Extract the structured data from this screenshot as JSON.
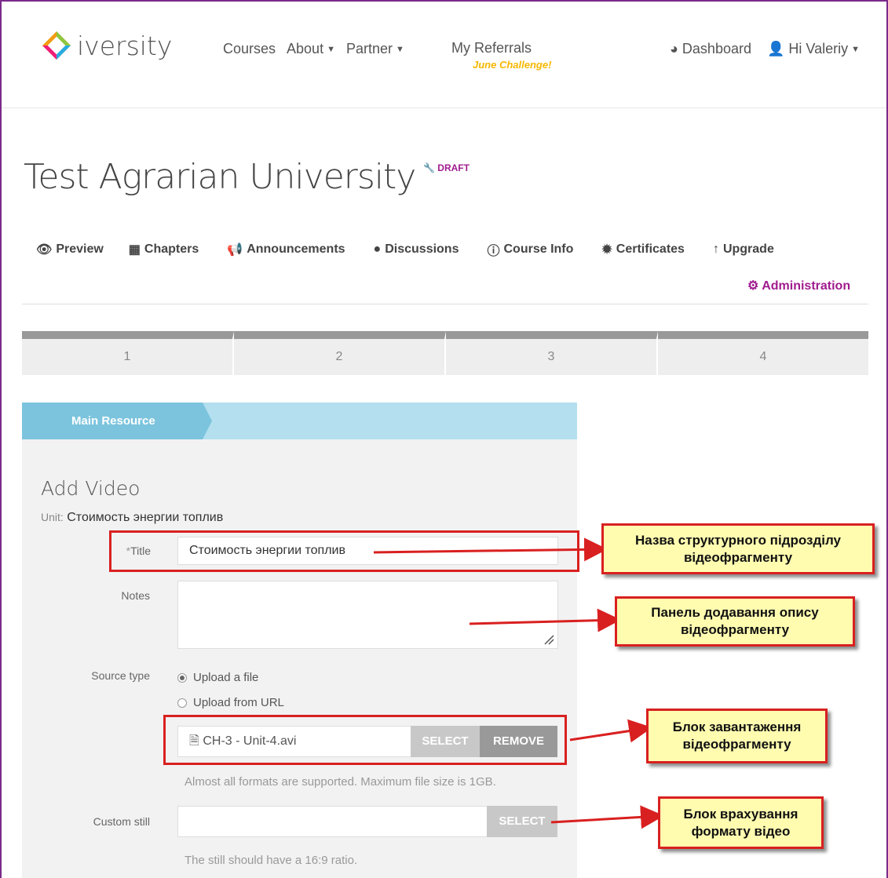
{
  "header": {
    "logo_text": "iversity",
    "nav": {
      "courses": "Courses",
      "about": "About",
      "partner": "Partner",
      "referrals": "My Referrals",
      "referrals_sub": "June Challenge!"
    },
    "dashboard": "Dashboard",
    "user": "Hi Valeriy"
  },
  "course": {
    "title": "Test Agrarian University",
    "status": "DRAFT"
  },
  "tabs": {
    "preview": "Preview",
    "chapters": "Chapters",
    "announcements": "Announcements",
    "discussions": "Discussions",
    "course_info": "Course Info",
    "certificates": "Certificates",
    "upgrade": "Upgrade",
    "administration": "Administration"
  },
  "steps": [
    "1",
    "2",
    "3",
    "4"
  ],
  "panel": {
    "tab_label": "Main Resource",
    "heading": "Add Video",
    "unit_label": "Unit:",
    "unit_value": "Стоимость энергии топлив"
  },
  "form": {
    "title_label": "Title",
    "title_required": "*",
    "title_value": "Стоимость энергии топлив",
    "notes_label": "Notes",
    "notes_value": "",
    "source_type_label": "Source type",
    "source_options": [
      {
        "label": "Upload a file",
        "selected": true
      },
      {
        "label": "Upload from URL",
        "selected": false
      }
    ],
    "file_name": "CH-3 - Unit-4.avi",
    "select_button": "SELECT",
    "remove_button": "REMOVE",
    "file_help": "Almost all formats are supported. Maximum file size is 1GB.",
    "custom_still_label": "Custom still",
    "custom_still_value": "",
    "still_select_button": "SELECT",
    "still_help": "The still should have a 16:9 ratio."
  },
  "annotations": {
    "title_note_1": "Назва структурного підрозділу",
    "title_note_2": "відеофрагменту",
    "notes_note_1": "Панель додавання опису",
    "notes_note_2": "відеофрагменту",
    "upload_note_1": "Блок завантаження",
    "upload_note_2": "відеофрагменту",
    "still_note_1": "Блок врахування",
    "still_note_2": "формату відео"
  },
  "colors": {
    "accent_purple": "#a01c8e",
    "challenge_yellow": "#f5b700",
    "panel_blue": "#b3dfef",
    "panel_tab_blue": "#7cc4dd",
    "annotation_red": "#d92020",
    "callout_yellow": "#fffcb0"
  }
}
